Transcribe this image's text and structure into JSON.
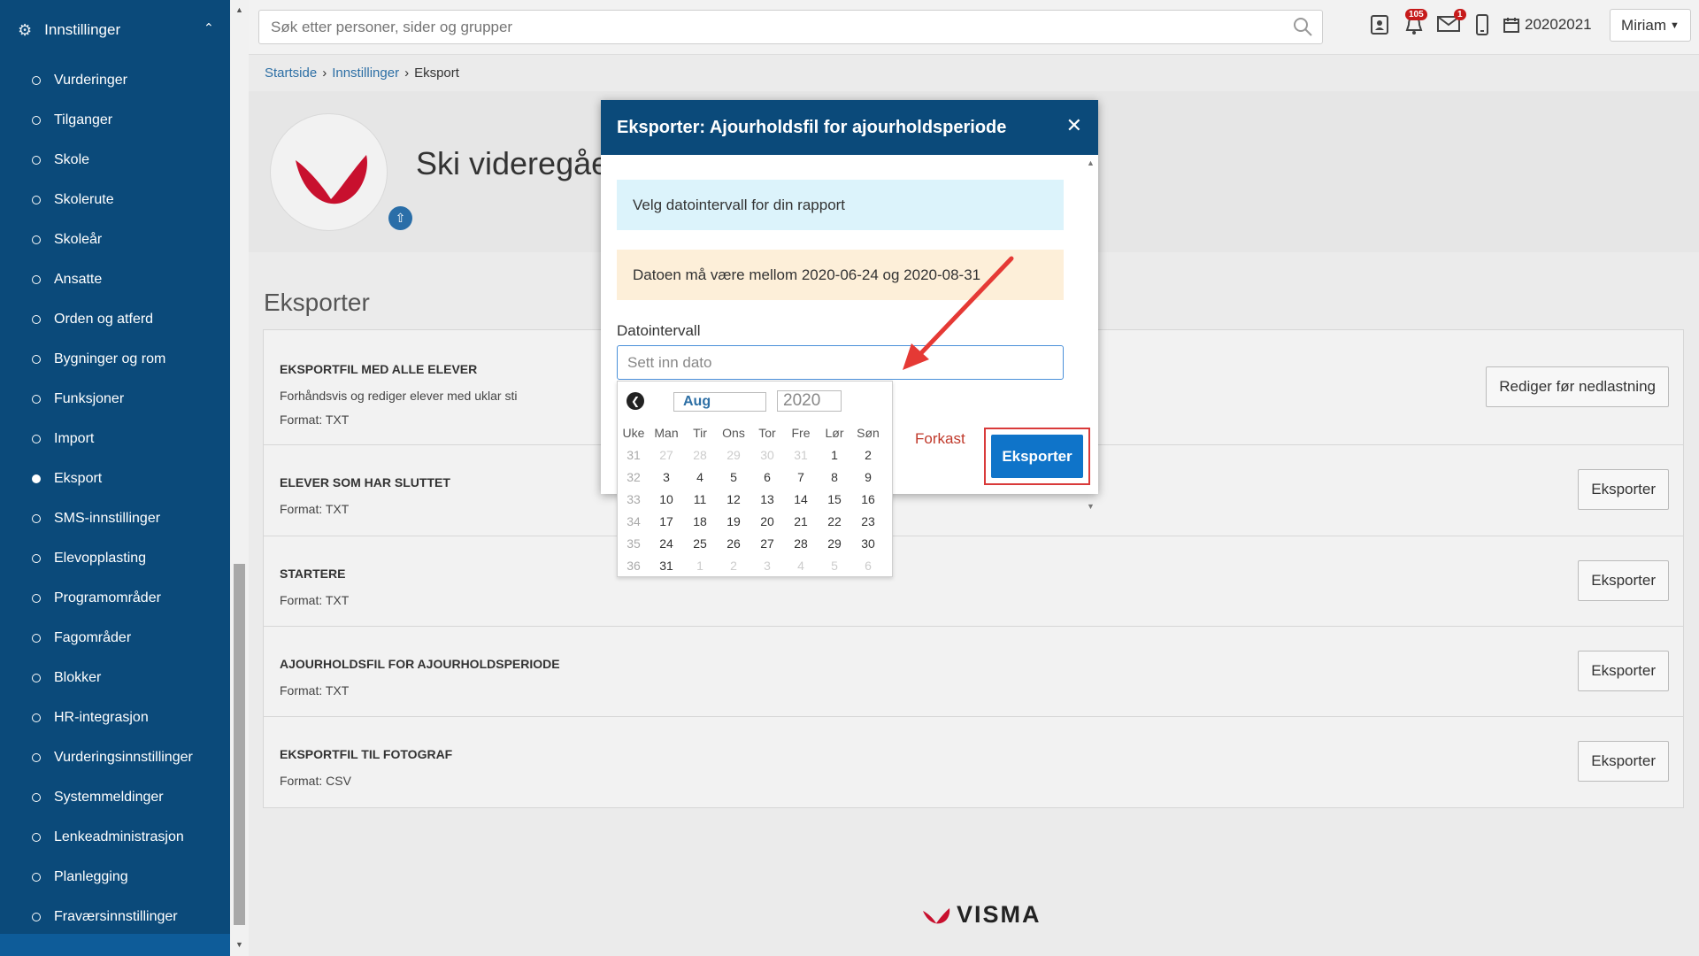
{
  "sidebar": {
    "title": "Innstillinger",
    "items": [
      {
        "label": "Vurderinger"
      },
      {
        "label": "Tilganger"
      },
      {
        "label": "Skole"
      },
      {
        "label": "Skolerute"
      },
      {
        "label": "Skoleår"
      },
      {
        "label": "Ansatte"
      },
      {
        "label": "Orden og atferd"
      },
      {
        "label": "Bygninger og rom"
      },
      {
        "label": "Funksjoner"
      },
      {
        "label": "Import"
      },
      {
        "label": "Eksport"
      },
      {
        "label": "SMS-innstillinger"
      },
      {
        "label": "Elevopplasting"
      },
      {
        "label": "Programområder"
      },
      {
        "label": "Fagområder"
      },
      {
        "label": "Blokker"
      },
      {
        "label": "HR-integrasjon"
      },
      {
        "label": "Vurderingsinnstillinger"
      },
      {
        "label": "Systemmeldinger"
      },
      {
        "label": "Lenkeadministrasjon"
      },
      {
        "label": "Planlegging"
      },
      {
        "label": "Fraværsinnstillinger"
      }
    ],
    "active_index": 10
  },
  "topbar": {
    "search_placeholder": "Søk etter personer, sider og grupper",
    "notifications_badge": "105",
    "messages_badge": "1",
    "period": "20202021",
    "user": "Miriam"
  },
  "breadcrumb": {
    "items": [
      "Startside",
      "Innstillinger",
      "Eksport"
    ]
  },
  "school": {
    "name": "Ski videregåe"
  },
  "export": {
    "heading": "Eksporter",
    "cards": [
      {
        "title": "EKSPORTFIL MED ALLE ELEVER",
        "desc": "Forhåndsvis og rediger elever med uklar sti",
        "format": "Format: TXT",
        "button": "Rediger før nedlastning"
      },
      {
        "title": "ELEVER SOM HAR SLUTTET",
        "format": "Format: TXT",
        "button": "Eksporter"
      },
      {
        "title": "STARTERE",
        "format": "Format: TXT",
        "button": "Eksporter"
      },
      {
        "title": "AJOURHOLDSFIL FOR AJOURHOLDSPERIODE",
        "format": "Format: TXT",
        "button": "Eksporter"
      },
      {
        "title": "EKSPORTFIL TIL FOTOGRAF",
        "format": "Format: CSV",
        "button": "Eksporter"
      }
    ]
  },
  "modal": {
    "title": "Eksporter: Ajourholdsfil for ajourholdsperiode",
    "info": "Velg datointervall for din rapport",
    "warning": "Datoen må være mellom 2020-06-24 og 2020-08-31",
    "date_label": "Datointervall",
    "date_placeholder": "Sett inn dato",
    "cancel": "Forkast",
    "submit": "Eksporter"
  },
  "datepicker": {
    "month": "Aug",
    "year": "2020",
    "headers": [
      "Uke",
      "Man",
      "Tir",
      "Ons",
      "Tor",
      "Fre",
      "Lør",
      "Søn"
    ],
    "weeks": [
      {
        "week": "31",
        "days": [
          "27",
          "28",
          "29",
          "30",
          "31",
          "1",
          "2"
        ],
        "muted": [
          true,
          true,
          true,
          true,
          true,
          false,
          false
        ]
      },
      {
        "week": "32",
        "days": [
          "3",
          "4",
          "5",
          "6",
          "7",
          "8",
          "9"
        ],
        "muted": [
          false,
          false,
          false,
          false,
          false,
          false,
          false
        ]
      },
      {
        "week": "33",
        "days": [
          "10",
          "11",
          "12",
          "13",
          "14",
          "15",
          "16"
        ],
        "muted": [
          false,
          false,
          false,
          false,
          false,
          false,
          false
        ]
      },
      {
        "week": "34",
        "days": [
          "17",
          "18",
          "19",
          "20",
          "21",
          "22",
          "23"
        ],
        "muted": [
          false,
          false,
          false,
          false,
          false,
          false,
          false
        ]
      },
      {
        "week": "35",
        "days": [
          "24",
          "25",
          "26",
          "27",
          "28",
          "29",
          "30"
        ],
        "muted": [
          false,
          false,
          false,
          false,
          false,
          false,
          false
        ]
      },
      {
        "week": "36",
        "days": [
          "31",
          "1",
          "2",
          "3",
          "4",
          "5",
          "6"
        ],
        "muted": [
          false,
          true,
          true,
          true,
          true,
          true,
          true
        ]
      }
    ]
  },
  "footer": {
    "brand": "VISMA"
  },
  "colors": {
    "sidebar_bg": "#0b4a7a",
    "modal_header": "#0b4a7a",
    "primary_button": "#0f74c9",
    "highlight_border": "#d93a3a",
    "cancel_text": "#c0392b",
    "info_bg": "#dcf3fb",
    "warning_bg": "#fdefd9"
  }
}
